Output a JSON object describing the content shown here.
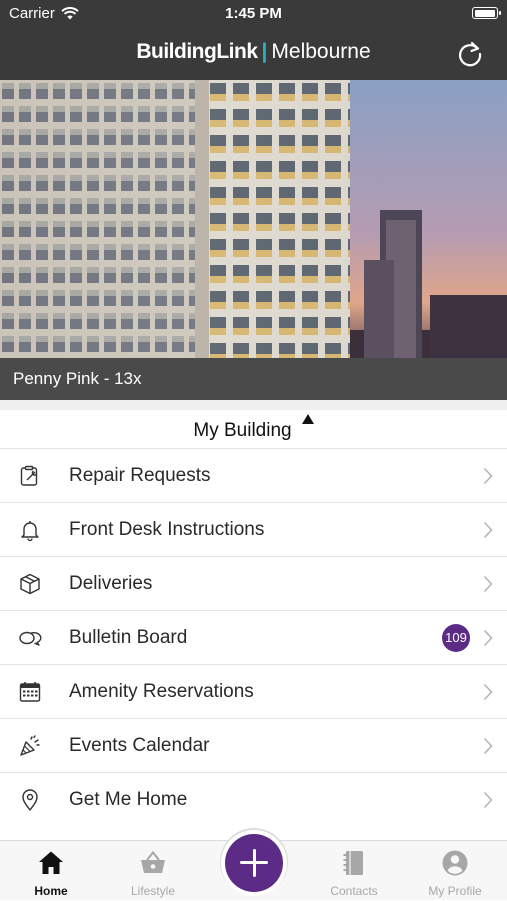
{
  "status": {
    "carrier": "Carrier",
    "time": "1:45 PM"
  },
  "header": {
    "brand_primary": "BuildingLink",
    "brand_separator": "|",
    "brand_location": "Melbourne"
  },
  "hero": {
    "caption": "Penny Pink - 13x"
  },
  "section": {
    "title": "My Building"
  },
  "menu": [
    {
      "label": "Repair Requests",
      "icon": "clipboard-wrench-icon"
    },
    {
      "label": "Front Desk Instructions",
      "icon": "bell-icon"
    },
    {
      "label": "Deliveries",
      "icon": "package-icon"
    },
    {
      "label": "Bulletin Board",
      "icon": "chat-bubbles-icon",
      "badge": "109"
    },
    {
      "label": "Amenity Reservations",
      "icon": "calendar-icon"
    },
    {
      "label": "Events Calendar",
      "icon": "party-popper-icon"
    },
    {
      "label": "Get Me Home",
      "icon": "location-pin-icon"
    }
  ],
  "tabs": [
    {
      "label": "Home",
      "icon": "home-icon",
      "active": true
    },
    {
      "label": "Lifestyle",
      "icon": "basket-icon"
    },
    {
      "label": "Contacts",
      "icon": "contacts-book-icon"
    },
    {
      "label": "My Profile",
      "icon": "profile-icon"
    }
  ],
  "colors": {
    "bar": "#3a3a3a",
    "accent": "#5b2b86",
    "brand_separator": "#2bb3c0"
  }
}
